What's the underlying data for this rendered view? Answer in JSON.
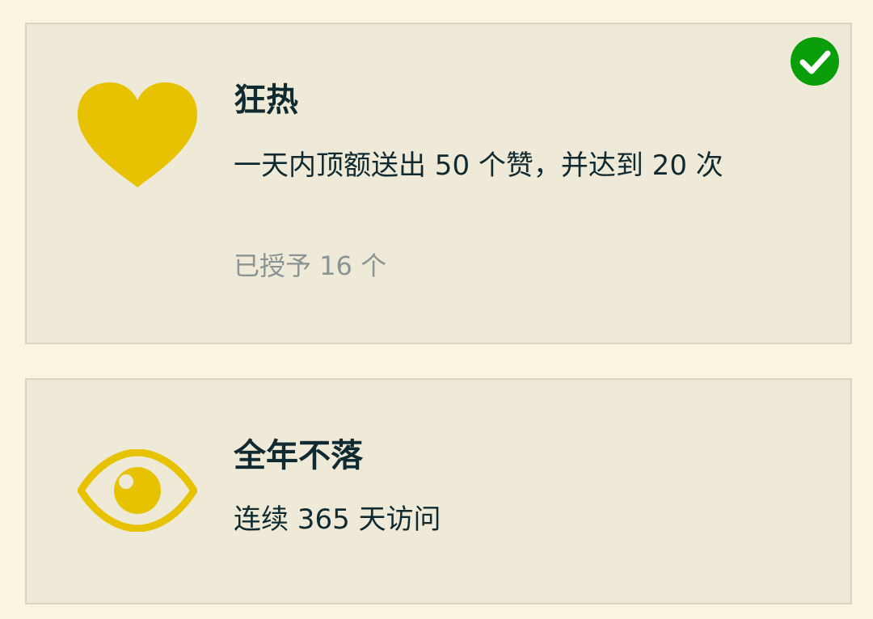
{
  "colors": {
    "background": "#fbf4e1",
    "card": "#efe9d7",
    "card_border": "#d6d6c4",
    "icon_accent": "#e6c200",
    "granted_check": "#0a9f0a",
    "text_primary": "#0f2a30",
    "text_secondary": "#8a9494"
  },
  "badges": [
    {
      "icon": "heart-icon",
      "title": "狂热",
      "description": "一天内顶额送出 50 个赞，并达到 20 次",
      "granted_count": "已授予 16 个",
      "granted": true,
      "granted_icon": "check-circle-icon"
    },
    {
      "icon": "eye-icon",
      "title": "全年不落",
      "description": "连续 365 天访问"
    }
  ]
}
